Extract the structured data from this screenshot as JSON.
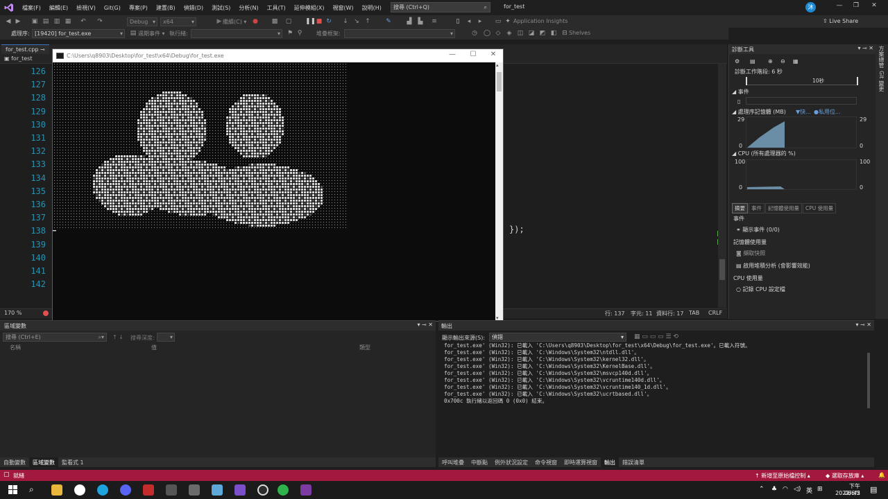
{
  "menu": {
    "items": [
      "檔案(F)",
      "編輯(E)",
      "檢視(V)",
      "Git(G)",
      "專案(P)",
      "建置(B)",
      "偵錯(D)",
      "測試(S)",
      "分析(N)",
      "工具(T)",
      "延伸模組(X)",
      "視窗(W)",
      "說明(H)"
    ],
    "search_placeholder": "搜尋 (Ctrl+Q)",
    "solution_name": "for_test",
    "user_initial": "沐"
  },
  "toolbar": {
    "config": "Debug",
    "platform": "x64",
    "process_label": "處理序:",
    "process_value": "[19420] for_test.exe",
    "lifecycle_label": "週期事件 ▾",
    "thread_label": "執行緒:",
    "stack_label": "堆疊框架:",
    "app_insights": "Application Insights",
    "shelves": "Shelves",
    "live_share": "Live Share"
  },
  "editor": {
    "tab_label": "for_test.cpp",
    "project": "for_test",
    "line_numbers": [
      "126",
      "127",
      "128",
      "129",
      "130",
      "131",
      "132",
      "133",
      "134",
      "135",
      "136",
      "137",
      "138",
      "139",
      "140",
      "141",
      "142"
    ],
    "code_fragment": "});",
    "zoom": "170 %",
    "status": {
      "line": "行: 137",
      "char": "字元: 11",
      "col": "資料行: 17",
      "tab": "TAB",
      "eol": "CRLF"
    }
  },
  "console": {
    "title": "C:\\Users\\q8903\\Desktop\\for_test\\x64\\Debug\\for_test.exe"
  },
  "diagnostics": {
    "title": "診斷工具",
    "session": "診斷工作階段: 6 秒",
    "timeline_label": "10秒",
    "events_section": "事件",
    "memory_section": "處理序記憶體 (MB)",
    "memory_legend": [
      "快...",
      "私用位..."
    ],
    "memory_max": "29",
    "memory_min": "0",
    "memory_max_right": "29",
    "memory_min_right": "0",
    "cpu_section": "CPU (所有處理器的 %)",
    "cpu_max": "100",
    "cpu_min": "0",
    "cpu_max_right": "100",
    "cpu_min_right": "0",
    "tabs": [
      "摘要",
      "事件",
      "記憶體使用量",
      "CPU 使用量"
    ],
    "summary_events_heading": "事件",
    "show_events": "顯示事件 (0/0)",
    "memory_usage_heading": "記憶體使用量",
    "take_snapshot": "擷取快照",
    "heap_profiling": "啟用堆積分析 (會影響效能)",
    "cpu_usage_heading": "CPU 使用量",
    "record_cpu": "記錄 CPU 設定檔",
    "side_tabs": [
      "方案總管",
      "Git 變更"
    ]
  },
  "locals": {
    "title": "區域變數",
    "search_placeholder": "搜尋 (Ctrl+E)",
    "search_depth_label": "搜尋深度:",
    "columns": [
      "名稱",
      "值",
      "類型"
    ],
    "tabs": [
      "自動變數",
      "區域變數",
      "監看式 1"
    ]
  },
  "output": {
    "title": "輸出",
    "source_label": "顯示輸出來源(S):",
    "source_value": "偵錯",
    "lines": [
      "for_test.exe' (Win32): 已載入 'C:\\Users\\q8903\\Desktop\\for_test\\x64\\Debug\\for_test.exe'。已載入符號。",
      "for_test.exe' (Win32): 已載入 'C:\\Windows\\System32\\ntdll.dll'。",
      "for_test.exe' (Win32): 已載入 'C:\\Windows\\System32\\kernel32.dll'。",
      "for_test.exe' (Win32): 已載入 'C:\\Windows\\System32\\KernelBase.dll'。",
      "for_test.exe' (Win32): 已載入 'C:\\Windows\\System32\\msvcp140d.dll'。",
      "for_test.exe' (Win32): 已載入 'C:\\Windows\\System32\\vcruntime140d.dll'。",
      "for_test.exe' (Win32): 已載入 'C:\\Windows\\System32\\vcruntime140_1d.dll'。",
      "for_test.exe' (Win32): 已載入 'C:\\Windows\\System32\\ucrtbased.dll'。",
      "0x700c 執行緒以返回碼 0 (0x0) 結束。"
    ],
    "tabs": [
      "呼叫堆疊",
      "中斷點",
      "例外狀況設定",
      "命令視窗",
      "即時運算視窗",
      "輸出",
      "錯誤清單"
    ]
  },
  "statusbar": {
    "ready": "就緒",
    "source_control": "新增至原始檔控制",
    "repository": "選取存放庫"
  },
  "taskbar": {
    "time": "下午 06:42",
    "date": "2022/6/5",
    "lang": "英"
  },
  "colors": {
    "accent": "#a3193d",
    "code_line_numbers": "#2b91af",
    "chart_fill": "#6a8ea6"
  }
}
